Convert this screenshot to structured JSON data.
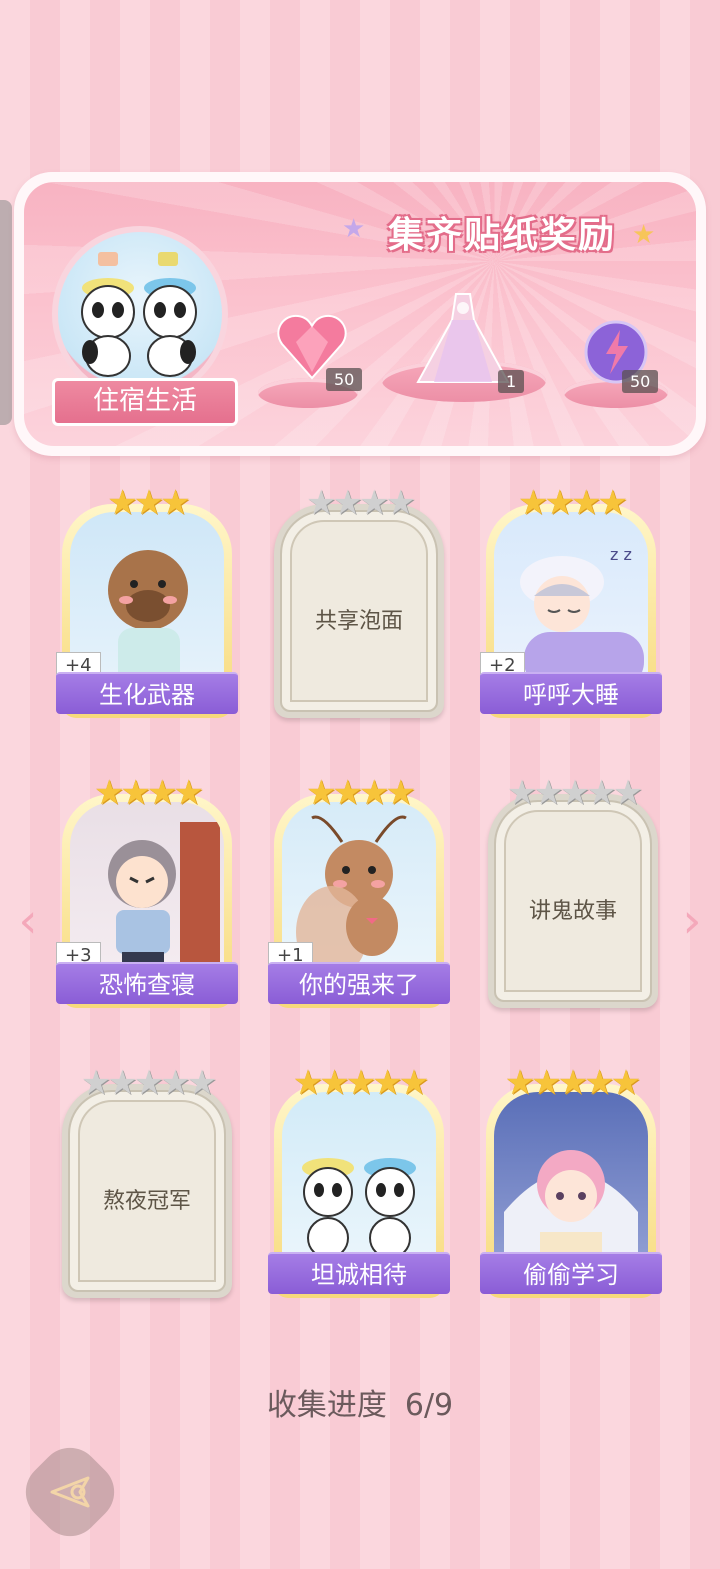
{
  "banner": {
    "title": "集齐贴纸奖励",
    "label": "住宿生活",
    "rewards": [
      {
        "name": "heart-gem",
        "count": "50"
      },
      {
        "name": "dress",
        "count": "1"
      },
      {
        "name": "lightning-orb",
        "count": "50"
      }
    ]
  },
  "cards": [
    {
      "name": "生化武器",
      "stars": 3,
      "max_stars": 3,
      "bonus": "+4",
      "collected": true
    },
    {
      "name": "共享泡面",
      "stars": 0,
      "max_stars": 4,
      "collected": false
    },
    {
      "name": "呼呼大睡",
      "stars": 4,
      "max_stars": 4,
      "bonus": "+2",
      "collected": true
    },
    {
      "name": "恐怖查寝",
      "stars": 4,
      "max_stars": 4,
      "bonus": "+3",
      "collected": true
    },
    {
      "name": "你的强来了",
      "stars": 4,
      "max_stars": 4,
      "bonus": "+1",
      "collected": true
    },
    {
      "name": "讲鬼故事",
      "stars": 0,
      "max_stars": 5,
      "collected": false
    },
    {
      "name": "熬夜冠军",
      "stars": 0,
      "max_stars": 5,
      "collected": false
    },
    {
      "name": "坦诚相待",
      "stars": 5,
      "max_stars": 5,
      "collected": true
    },
    {
      "name": "偷偷学习",
      "stars": 5,
      "max_stars": 5,
      "collected": true
    }
  ],
  "progress": {
    "label": "收集进度",
    "count": "6/9",
    "value": 0.667
  },
  "nav": {
    "prev_icon": "chevron-left-icon",
    "next_icon": "chevron-right-icon",
    "back_icon": "back-icon"
  },
  "colors": {
    "accent": "#8a5dd6",
    "banner": "#f8b3c2",
    "star": "#f7c43a"
  }
}
